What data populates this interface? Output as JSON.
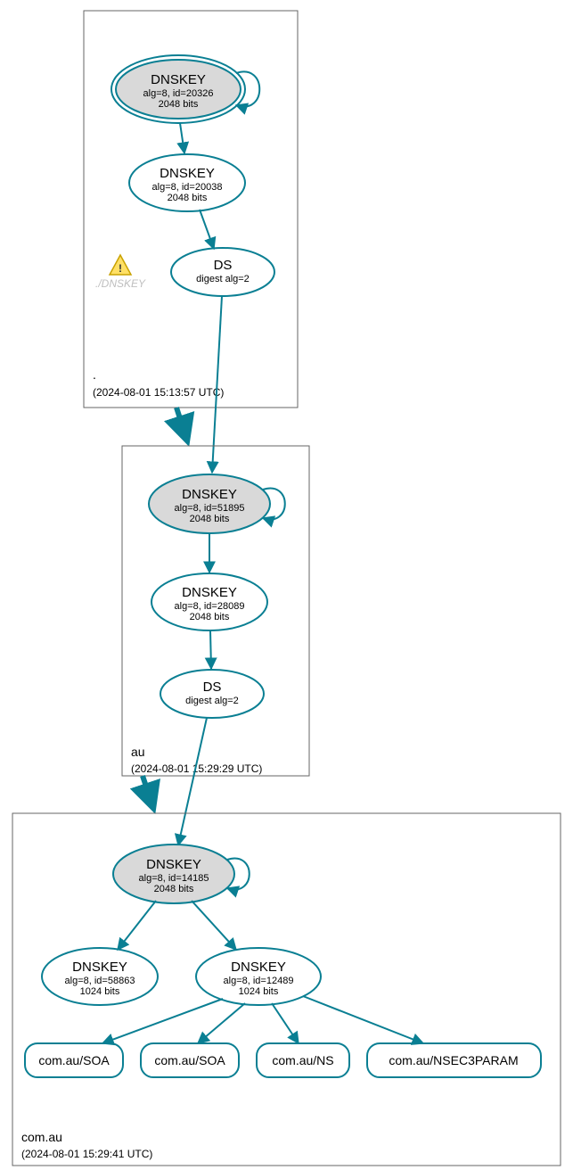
{
  "colors": {
    "stroke": "#0a7f93",
    "ksk_fill": "#d9d9d9",
    "box": "#666666"
  },
  "zones": [
    {
      "name": ".",
      "timestamp": "(2024-08-01 15:13:57 UTC)"
    },
    {
      "name": "au",
      "timestamp": "(2024-08-01 15:29:29 UTC)"
    },
    {
      "name": "com.au",
      "timestamp": "(2024-08-01 15:29:41 UTC)"
    }
  ],
  "nodes": {
    "root_ksk": {
      "title": "DNSKEY",
      "line2": "alg=8, id=20326",
      "line3": "2048 bits"
    },
    "root_zsk": {
      "title": "DNSKEY",
      "line2": "alg=8, id=20038",
      "line3": "2048 bits"
    },
    "root_ds": {
      "title": "DS",
      "line2": "digest alg=2"
    },
    "root_warn": {
      "label": "./DNSKEY"
    },
    "au_ksk": {
      "title": "DNSKEY",
      "line2": "alg=8, id=51895",
      "line3": "2048 bits"
    },
    "au_zsk": {
      "title": "DNSKEY",
      "line2": "alg=8, id=28089",
      "line3": "2048 bits"
    },
    "au_ds": {
      "title": "DS",
      "line2": "digest alg=2"
    },
    "com_ksk": {
      "title": "DNSKEY",
      "line2": "alg=8, id=14185",
      "line3": "2048 bits"
    },
    "com_zsk1": {
      "title": "DNSKEY",
      "line2": "alg=8, id=58863",
      "line3": "1024 bits"
    },
    "com_zsk2": {
      "title": "DNSKEY",
      "line2": "alg=8, id=12489",
      "line3": "1024 bits"
    }
  },
  "rrsets": {
    "soa1": "com.au/SOA",
    "soa2": "com.au/SOA",
    "ns": "com.au/NS",
    "nsec": "com.au/NSEC3PARAM"
  },
  "chart_data": {
    "type": "diagram",
    "description": "DNSSEC authentication chain / dependency graph for com.au",
    "zones": [
      {
        "zone": ".",
        "queried": "2024-08-01 15:13:57 UTC",
        "keys": [
          {
            "role": "KSK",
            "rrtype": "DNSKEY",
            "alg": 8,
            "id": 20326,
            "bits": 2048,
            "self_signed": true,
            "trust_anchor": true
          },
          {
            "role": "ZSK",
            "rrtype": "DNSKEY",
            "alg": 8,
            "id": 20038,
            "bits": 2048
          }
        ],
        "ds": [
          {
            "digest_alg": 2,
            "for_zone": "au"
          }
        ],
        "warnings": [
          "./DNSKEY"
        ]
      },
      {
        "zone": "au",
        "queried": "2024-08-01 15:29:29 UTC",
        "keys": [
          {
            "role": "KSK",
            "rrtype": "DNSKEY",
            "alg": 8,
            "id": 51895,
            "bits": 2048,
            "self_signed": true
          },
          {
            "role": "ZSK",
            "rrtype": "DNSKEY",
            "alg": 8,
            "id": 28089,
            "bits": 2048
          }
        ],
        "ds": [
          {
            "digest_alg": 2,
            "for_zone": "com.au"
          }
        ]
      },
      {
        "zone": "com.au",
        "queried": "2024-08-01 15:29:41 UTC",
        "keys": [
          {
            "role": "KSK",
            "rrtype": "DNSKEY",
            "alg": 8,
            "id": 14185,
            "bits": 2048,
            "self_signed": true
          },
          {
            "role": "ZSK",
            "rrtype": "DNSKEY",
            "alg": 8,
            "id": 58863,
            "bits": 1024
          },
          {
            "role": "ZSK",
            "rrtype": "DNSKEY",
            "alg": 8,
            "id": 12489,
            "bits": 1024
          }
        ],
        "rrsets_signed": [
          "com.au/SOA",
          "com.au/SOA",
          "com.au/NS",
          "com.au/NSEC3PARAM"
        ]
      }
    ],
    "edges": [
      {
        "from": "root.KSK.20326",
        "to": "root.KSK.20326",
        "kind": "self-sig"
      },
      {
        "from": "root.KSK.20326",
        "to": "root.ZSK.20038",
        "kind": "signs"
      },
      {
        "from": "root.ZSK.20038",
        "to": "root.DS(au)",
        "kind": "signs"
      },
      {
        "from": "root.DS(au)",
        "to": "au.KSK.51895",
        "kind": "delegation"
      },
      {
        "from": "root zone box",
        "to": "au zone box",
        "kind": "zone-link"
      },
      {
        "from": "au.KSK.51895",
        "to": "au.KSK.51895",
        "kind": "self-sig"
      },
      {
        "from": "au.KSK.51895",
        "to": "au.ZSK.28089",
        "kind": "signs"
      },
      {
        "from": "au.ZSK.28089",
        "to": "au.DS(com.au)",
        "kind": "signs"
      },
      {
        "from": "au.DS(com.au)",
        "to": "com.KSK.14185",
        "kind": "delegation"
      },
      {
        "from": "au zone box",
        "to": "com.au zone box",
        "kind": "zone-link"
      },
      {
        "from": "com.KSK.14185",
        "to": "com.KSK.14185",
        "kind": "self-sig"
      },
      {
        "from": "com.KSK.14185",
        "to": "com.ZSK.58863",
        "kind": "signs"
      },
      {
        "from": "com.KSK.14185",
        "to": "com.ZSK.12489",
        "kind": "signs"
      },
      {
        "from": "com.ZSK.12489",
        "to": "com.au/SOA",
        "kind": "signs"
      },
      {
        "from": "com.ZSK.12489",
        "to": "com.au/SOA",
        "kind": "signs"
      },
      {
        "from": "com.ZSK.12489",
        "to": "com.au/NS",
        "kind": "signs"
      },
      {
        "from": "com.ZSK.12489",
        "to": "com.au/NSEC3PARAM",
        "kind": "signs"
      }
    ]
  }
}
